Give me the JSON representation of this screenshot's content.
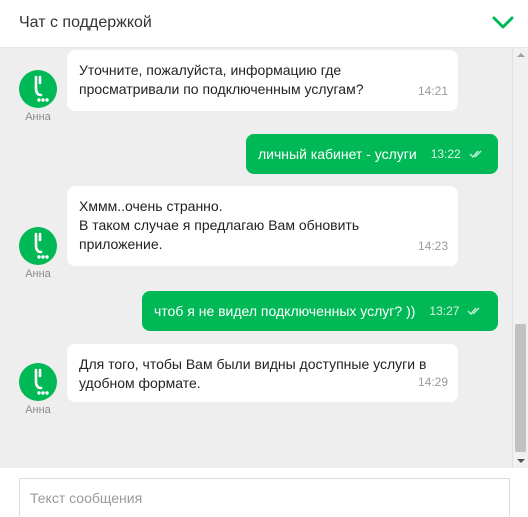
{
  "header": {
    "title": "Чат с поддержкой"
  },
  "messages": [
    {
      "agent_name": "Анна",
      "lines": [
        "Уточните, пожалуйста, информацию где",
        "просматривали по подключенным услугам?"
      ],
      "time": "14:21"
    },
    {
      "text": "личный кабинет - услуги",
      "time": "13:22"
    },
    {
      "agent_name": "Анна",
      "lines": [
        "Хммм..очень странно.",
        "В таком случае я предлагаю Вам обновить",
        "приложение."
      ],
      "time": "14:23"
    },
    {
      "text": "чтоб я не видел подключенных услуг? ))",
      "time": "13:27"
    },
    {
      "agent_name": "Анна",
      "lines": [
        "Для того, чтобы Вам были видны доступные услуги в",
        "удобном формате."
      ],
      "time": "14:29"
    }
  ],
  "composer": {
    "placeholder": "Текст сообщения"
  },
  "colors": {
    "brand": "#00b956",
    "chat_bg": "#eeeeee"
  }
}
